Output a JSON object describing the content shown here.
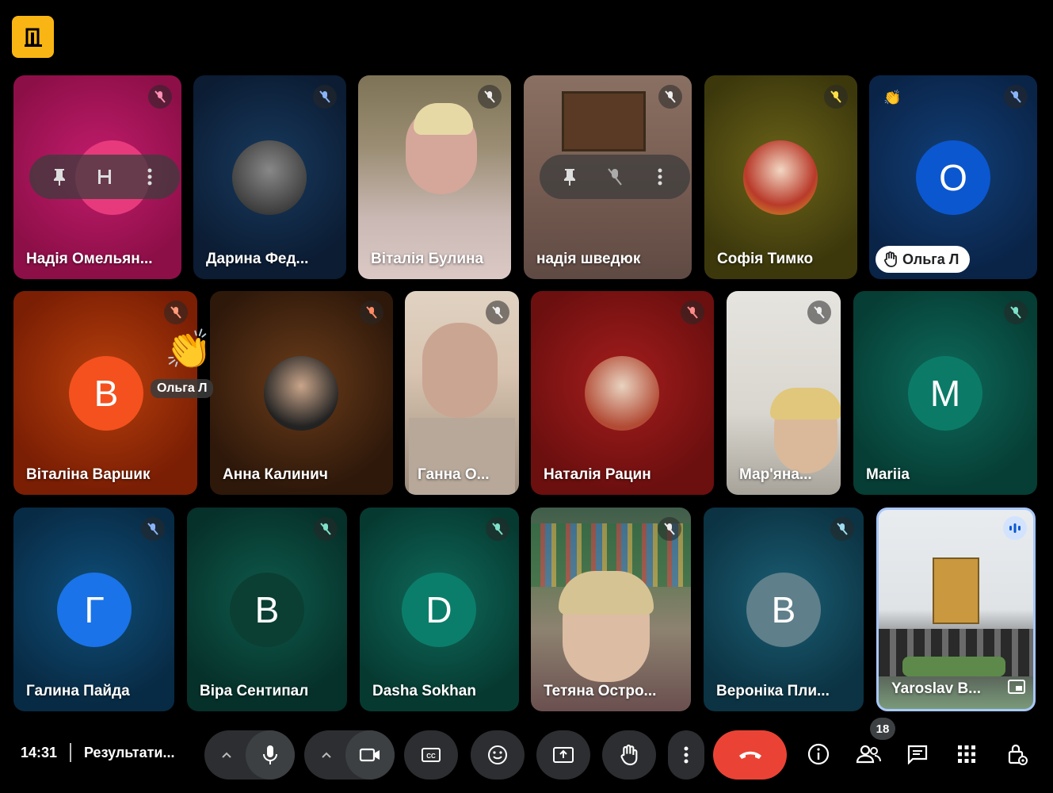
{
  "participants": [
    {
      "name": "Надія Омельян..."
    },
    {
      "name": "Дарина Фед..."
    },
    {
      "name": "Віталія Булина"
    },
    {
      "name": "надія шведюк"
    },
    {
      "name": "Софія Тимко"
    },
    {
      "name": "",
      "avatar_letter": "О",
      "hand_raised_label": "Ольга Л"
    },
    {
      "name": "Віталіна Варшик",
      "avatar_letter": "В"
    },
    {
      "name": "Анна Калинич"
    },
    {
      "name": "Ганна О..."
    },
    {
      "name": "Наталія Рацин"
    },
    {
      "name": "Мар'яна..."
    },
    {
      "name": "Mariia",
      "avatar_letter": "M"
    },
    {
      "name": "Галина Пайда",
      "avatar_letter": "Г"
    },
    {
      "name": "Віра Сентипал",
      "avatar_letter": "В"
    },
    {
      "name": "Dasha Sokhan",
      "avatar_letter": "D"
    },
    {
      "name": "Тетяна Остро..."
    },
    {
      "name": "Вероніка Пли...",
      "avatar_letter": "В"
    },
    {
      "name": "Yaroslav B..."
    }
  ],
  "reaction": {
    "label": "Ольга Л",
    "emoji": "👏"
  },
  "bottom_bar": {
    "time": "14:31",
    "meeting_title": "Результати...",
    "participants_count": "18"
  },
  "colors": {
    "accent_yellow": "#f9b513",
    "end_call_red": "#ea4335",
    "control_bg": "#2d2e31"
  },
  "icons": [
    "door-icon",
    "mic-off-icon",
    "pin-icon",
    "more-vert-icon",
    "hand-icon",
    "mic-icon",
    "camera-icon",
    "chevron-up-icon",
    "captions-icon",
    "emoji-icon",
    "present-icon",
    "raise-hand-icon",
    "end-call-icon",
    "info-icon",
    "people-icon",
    "chat-icon",
    "activities-icon",
    "host-controls-icon",
    "speaking-icon",
    "pip-icon"
  ]
}
